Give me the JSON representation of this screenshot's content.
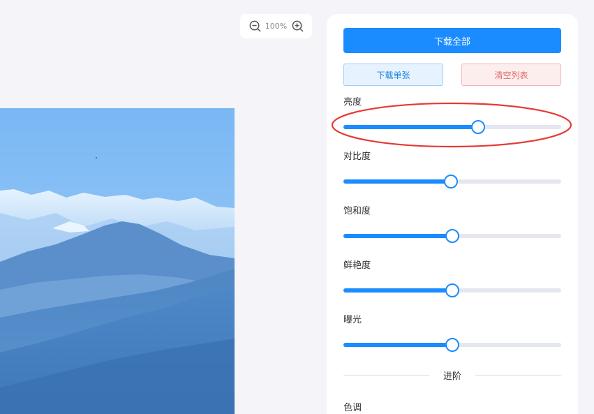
{
  "zoom": {
    "level": "100%",
    "zoom_out_icon": "zoom-out-icon",
    "zoom_in_icon": "zoom-in-icon"
  },
  "actions": {
    "download_all": "下载全部",
    "download_single": "下载单张",
    "clear_list": "清空列表"
  },
  "adjustments": [
    {
      "label": "亮度",
      "value": 0.62
    },
    {
      "label": "对比度",
      "value": 0.495
    },
    {
      "label": "饱和度",
      "value": 0.5
    },
    {
      "label": "鲜艳度",
      "value": 0.5
    },
    {
      "label": "曝光",
      "value": 0.5
    }
  ],
  "advanced": {
    "divider_label": "进阶",
    "first_setting": "色调"
  },
  "colors": {
    "accent": "#1a8cff",
    "danger": "#e46a6a",
    "annotation": "#e53935"
  }
}
